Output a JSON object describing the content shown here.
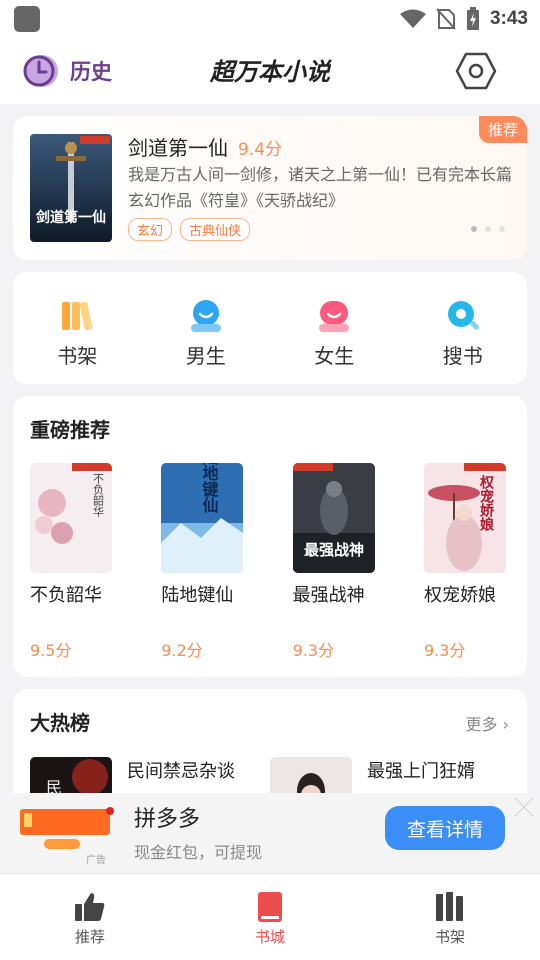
{
  "status_bar": {
    "time": "3:43"
  },
  "app_bar": {
    "history_label": "历史",
    "title": "超万本小说"
  },
  "banner": {
    "tag": "推荐",
    "book_title": "剑道第一仙",
    "score": "9.4分",
    "description": "我是万古人间一剑修，诸天之上第一仙！已有完本长篇玄幻作品《符皇》《天骄战纪》",
    "tags": [
      "玄幻",
      "古典仙侠"
    ],
    "cover_text": "剑道第一仙"
  },
  "quick_nav": {
    "items": [
      {
        "label": "书架",
        "icon": "bookshelf-icon",
        "color": "#ffa638"
      },
      {
        "label": "男生",
        "icon": "male-icon",
        "color": "#2fa6f2"
      },
      {
        "label": "女生",
        "icon": "female-icon",
        "color": "#ff5b7f"
      },
      {
        "label": "搜书",
        "icon": "search-icon",
        "color": "#25b7e8"
      }
    ]
  },
  "featured": {
    "title": "重磅推荐",
    "books": [
      {
        "name": "不负韶华",
        "score": "9.5分",
        "cover_text": "不负韶华"
      },
      {
        "name": "陆地键仙",
        "score": "9.2分",
        "cover_text": "陆地键仙"
      },
      {
        "name": "最强战神",
        "score": "9.3分",
        "cover_text": "最强战神"
      },
      {
        "name": "权宠娇娘",
        "score": "9.3分",
        "cover_text": "权宠娇娘"
      }
    ]
  },
  "hot_list": {
    "title": "大热榜",
    "more_label": "更多",
    "items": [
      {
        "name": "民间禁忌杂谈"
      },
      {
        "name": "最强上门狂婿"
      }
    ]
  },
  "ad": {
    "title": "拼多多",
    "subtitle": "现金红包，可提现",
    "button_label": "查看详情",
    "ad_label": "广告"
  },
  "tab_bar": {
    "tabs": [
      {
        "label": "推荐",
        "active": false
      },
      {
        "label": "书城",
        "active": true
      },
      {
        "label": "书架",
        "active": false
      }
    ]
  },
  "colors": {
    "accent": "#ff8a4c",
    "active_tab": "#ee4d4d",
    "ad_button": "#3a8ef6"
  }
}
